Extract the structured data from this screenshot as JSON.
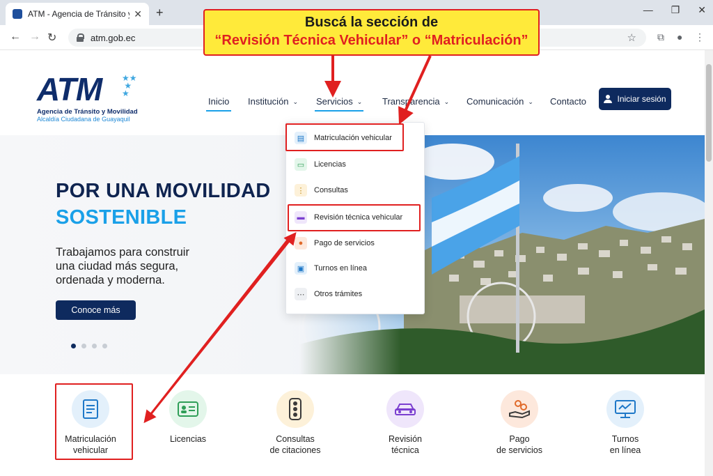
{
  "browser": {
    "tab_title": "ATM - Agencia de Tránsito y Movilidad",
    "url": "atm.gob.ec"
  },
  "annotation": {
    "line1": "Buscá la sección de",
    "line2": "“Revisión Técnica Vehicular” o “Matriculación”"
  },
  "logo": {
    "main": "ATM",
    "line1": "Agencia de Tránsito y Movilidad",
    "line2": "Alcaldía Ciudadana de Guayaquil"
  },
  "nav": {
    "items": [
      "Inicio",
      "Institución",
      "Servicios",
      "Transparencia",
      "Comunicación",
      "Contacto"
    ],
    "login": "Iniciar sesión"
  },
  "dropdown": {
    "items": [
      {
        "label": "Matriculación vehicular",
        "icon": "document-icon"
      },
      {
        "label": "Licencias",
        "icon": "license-card-icon"
      },
      {
        "label": "Consultas",
        "icon": "traffic-light-icon"
      },
      {
        "label": "Revisión técnica vehicular",
        "icon": "car-icon"
      },
      {
        "label": "Pago de servicios",
        "icon": "payment-hand-icon"
      },
      {
        "label": "Turnos en línea",
        "icon": "monitor-icon"
      },
      {
        "label": "Otros trámites",
        "icon": "more-dots-icon"
      }
    ]
  },
  "hero": {
    "title_line1": "POR UNA MOVILIDAD",
    "title_line2": "SOSTENIBLE",
    "text": "Trabajamos para construir una ciudad más segura, ordenada y moderna.",
    "button": "Conoce más"
  },
  "services": {
    "items": [
      {
        "line1": "Matriculación",
        "line2": "vehicular"
      },
      {
        "line1": "Licencias",
        "line2": ""
      },
      {
        "line1": "Consultas",
        "line2": "de citaciones"
      },
      {
        "line1": "Revisión",
        "line2": "técnica"
      },
      {
        "line1": "Pago",
        "line2": "de servicios"
      },
      {
        "line1": "Turnos",
        "line2": "en línea"
      }
    ]
  },
  "colors": {
    "navy": "#0e2a5e",
    "accent_blue": "#1aa0e8",
    "annotation_red": "#e02020",
    "annotation_yellow": "#ffea3a"
  }
}
